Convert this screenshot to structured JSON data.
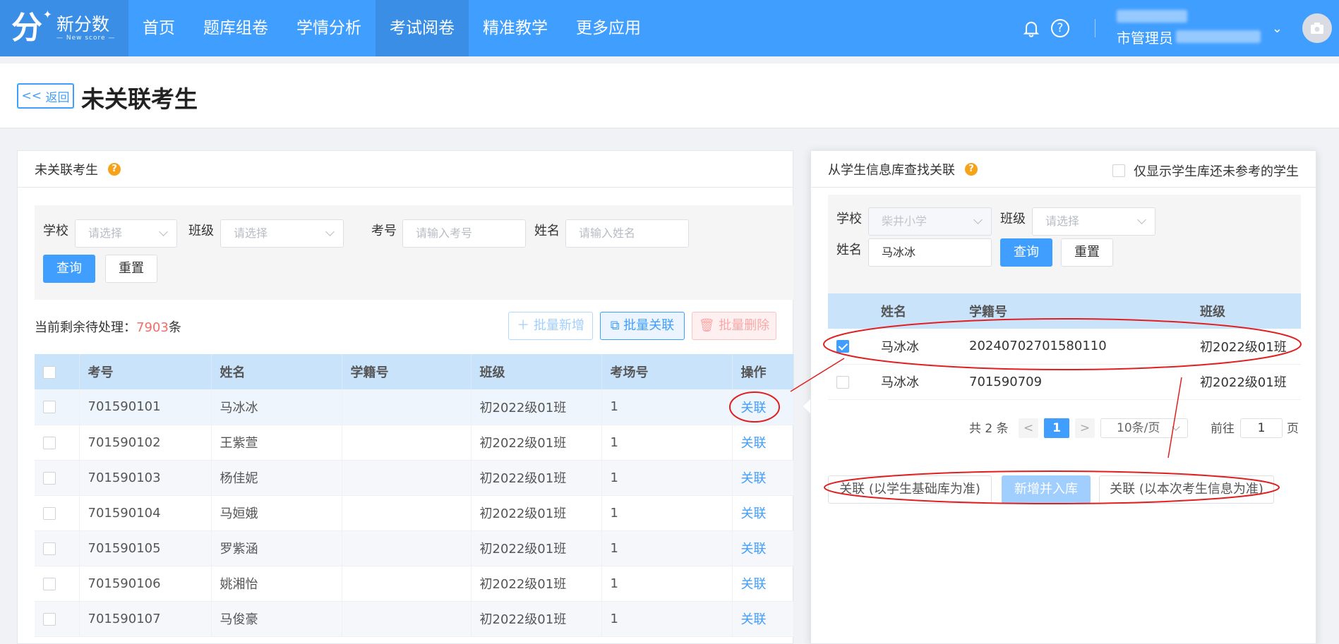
{
  "brand": {
    "name_cn": "新分数",
    "name_en": "— New score —",
    "glyph": "分"
  },
  "nav": [
    "首页",
    "题库组卷",
    "学情分析",
    "考试阅卷",
    "精准教学",
    "更多应用"
  ],
  "nav_active_index": 3,
  "user": {
    "role": "市管理员"
  },
  "header": {
    "back_label": "返回",
    "title": "未关联考生"
  },
  "left": {
    "title": "未关联考生",
    "filters": {
      "school_label": "学校",
      "school_placeholder": "请选择",
      "class_label": "班级",
      "class_placeholder": "请选择",
      "exam_no_label": "考号",
      "exam_no_placeholder": "请输入考号",
      "name_label": "姓名",
      "name_placeholder": "请输入姓名",
      "query": "查询",
      "reset": "重置"
    },
    "remaining_prefix": "当前剩余待处理：",
    "remaining_count": "7903",
    "remaining_suffix": "条",
    "actions": {
      "batch_add": "批量新增",
      "batch_link": "批量关联",
      "batch_delete": "批量删除"
    },
    "columns": [
      "考号",
      "姓名",
      "学籍号",
      "班级",
      "考场号",
      "操作"
    ],
    "rows": [
      {
        "exam_no": "701590101",
        "name": "马冰冰",
        "student_no": "",
        "class": "初2022级01班",
        "room": "1",
        "op": "关联"
      },
      {
        "exam_no": "701590102",
        "name": "王紫萱",
        "student_no": "",
        "class": "初2022级01班",
        "room": "1",
        "op": "关联"
      },
      {
        "exam_no": "701590103",
        "name": "杨佳妮",
        "student_no": "",
        "class": "初2022级01班",
        "room": "1",
        "op": "关联"
      },
      {
        "exam_no": "701590104",
        "name": "马姮娥",
        "student_no": "",
        "class": "初2022级01班",
        "room": "1",
        "op": "关联"
      },
      {
        "exam_no": "701590105",
        "name": "罗紫涵",
        "student_no": "",
        "class": "初2022级01班",
        "room": "1",
        "op": "关联"
      },
      {
        "exam_no": "701590106",
        "name": "姚湘怡",
        "student_no": "",
        "class": "初2022级01班",
        "room": "1",
        "op": "关联"
      },
      {
        "exam_no": "701590107",
        "name": "马俊豪",
        "student_no": "",
        "class": "初2022级01班",
        "room": "1",
        "op": "关联"
      }
    ]
  },
  "right": {
    "title": "从学生信息库查找关联",
    "only_show_label": "仅显示学生库还未参考的学生",
    "filters": {
      "school_label": "学校",
      "school_value": "柴井小学",
      "class_label": "班级",
      "class_placeholder": "请选择",
      "name_label": "姓名",
      "name_value": "马冰冰",
      "query": "查询",
      "reset": "重置"
    },
    "columns": [
      "姓名",
      "学籍号",
      "班级"
    ],
    "rows": [
      {
        "name": "马冰冰",
        "student_no": "20240702701580110",
        "class": "初2022级01班",
        "checked": true
      },
      {
        "name": "马冰冰",
        "student_no": "701590709",
        "class": "初2022级01班",
        "checked": false
      }
    ],
    "pagination": {
      "total": "共 2 条",
      "prev": "<",
      "page": "1",
      "next": ">",
      "page_size": "10条/页",
      "goto_label": "前往",
      "goto_value": "1",
      "page_suffix": "页"
    },
    "buttons": {
      "link_by_base": "关联 (以学生基础库为准)",
      "add_to_lib": "新增并入库",
      "link_by_exam": "关联 (以本次考生信息为准)"
    }
  },
  "colors": {
    "primary": "#409eff",
    "nav_active": "#3a8ee6",
    "danger": "#f56c6c",
    "annotation": "#e02020"
  }
}
